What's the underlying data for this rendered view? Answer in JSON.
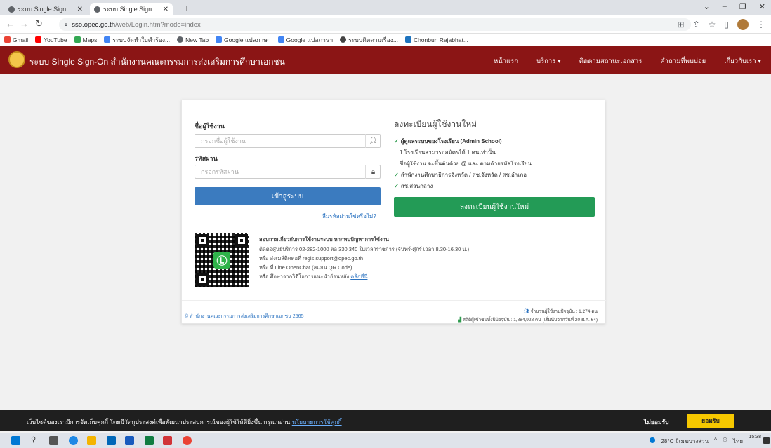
{
  "browser": {
    "tabs": [
      {
        "title": "ระบบ Single Sign-On สำนักงานคณะ",
        "active": false
      },
      {
        "title": "ระบบ Single Sign-On สำนักงานคณะ",
        "active": true
      }
    ],
    "url_host": "sso.opec.go.th",
    "url_path": "/web/Login.htm?mode=index",
    "bookmarks": [
      "Gmail",
      "YouTube",
      "Maps",
      "ระบบจัดทำใบคำร้อง...",
      "New Tab",
      "Google แปลภาษา",
      "Google แปลภาษา",
      "ระบบติดตามเรื่อง...",
      "Chonburi Rajabhat..."
    ]
  },
  "app": {
    "title": "ระบบ Single Sign-On สำนักงานคณะกรรมการส่งเสริมการศึกษาเอกชน",
    "menu": [
      "หน้าแรก",
      "บริการ ▾",
      "ติดตามสถานะเอกสาร",
      "คำถามที่พบบ่อย",
      "เกี่ยวกับเรา ▾"
    ]
  },
  "login": {
    "username_label": "ชื่อผู้ใช้งาน",
    "username_placeholder": "กรอกชื่อผู้ใช้งาน",
    "password_label": "รหัสผ่าน",
    "password_placeholder": "กรอกรหัสผ่าน",
    "submit_label": "เข้าสู่ระบบ",
    "forgot_label": "ลืมรหัสผ่านใช่หรือไม่?"
  },
  "register": {
    "title": "ลงทะเบียนผู้ใช้งานใหม่",
    "items": [
      "ผู้ดูแลระบบของโรงเรียน (Admin School)",
      "1 โรงเรียนสามารถสมัครได้ 1 คนเท่านั้น",
      "ชื่อผู้ใช้งาน จะขึ้นต้นด้วย @ และ ตามด้วยรหัสโรงเรียน",
      "สำนักงานศึกษาธิการจังหวัด / สช.จังหวัด / สช.อำเภอ",
      "สช.ส่วนกลาง"
    ],
    "button_label": "ลงทะเบียนผู้ใช้งานใหม่"
  },
  "help": {
    "heading": "สอบถามเกี่ยวกับการใช้งานระบบ หากพบปัญหาการใช้งาน",
    "line1": "ติดต่อศูนย์บริการ 02-282-1000 ต่อ 330,340 ในเวลาราชการ (จันทร์-ศุกร์ เวลา 8.30-16.30 น.)",
    "line2": "หรือ ส่งเมล์ติดต่อที่ regis.support@opec.go.th",
    "line3": "หรือ ที่ Line OpenChat (สแกน QR Code)",
    "line4": "หรือ ศึกษาจากวิดีโอการแนะนำย้อนหลัง",
    "line4_link": "คลิกที่นี่"
  },
  "footer": {
    "copyright": "© สำนักงานคณะกรรมการส่งเสริมการศึกษาเอกชน 2565",
    "online_users": "จำนวนผู้ใช้งานปัจจุบัน : 1,274 คน",
    "total_users": "สถิติผู้เข้าชมทั้งปีปัจจุบัน : 1,884,928 คน (เริ่มนับจากวันที่ 20 ธ.ค. 64)"
  },
  "cookie": {
    "message": "เว็บไซต์ของเรามีการจัดเก็บคุกกี้ โดยมีวัตถุประสงค์เพื่อพัฒนาประสบการณ์ของผู้ใช้ให้ดียิ่งขึ้น กรุณาอ่าน",
    "policy_link": "นโยบายการใช้คุกกี้",
    "decline_label": "ไม่ยอมรับ",
    "accept_label": "ยอมรับ"
  },
  "taskbar": {
    "weather": "28°C มีเมฆบางส่วน",
    "lang": "ไทย",
    "time": "15:38"
  }
}
